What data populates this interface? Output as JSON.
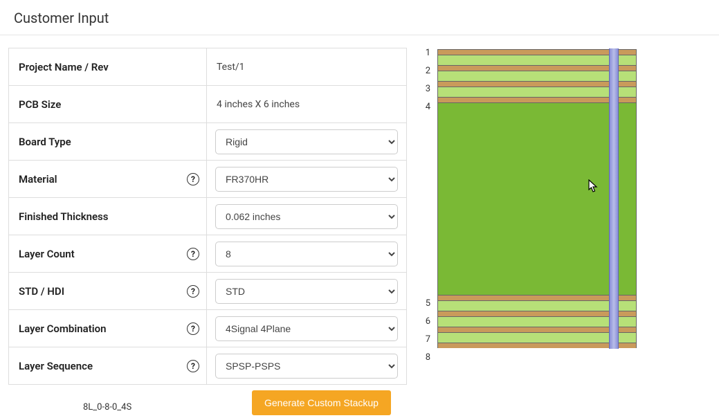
{
  "page": {
    "title": "Customer Input"
  },
  "form": {
    "project_name": {
      "label": "Project Name / Rev",
      "value": "Test/1"
    },
    "pcb_size": {
      "label": "PCB Size",
      "value": "4 inches X 6 inches"
    },
    "board_type": {
      "label": "Board Type",
      "value": "Rigid"
    },
    "material": {
      "label": "Material",
      "value": "FR370HR"
    },
    "finished_thickness": {
      "label": "Finished Thickness",
      "value": "0.062 inches"
    },
    "layer_count": {
      "label": "Layer Count",
      "value": "8"
    },
    "std_hdi": {
      "label": "STD / HDI",
      "value": "STD"
    },
    "layer_combination": {
      "label": "Layer Combination",
      "value": "4Signal 4Plane"
    },
    "layer_sequence": {
      "label": "Layer Sequence",
      "value": "SPSP-PSPS"
    }
  },
  "footer": {
    "code": "8L_0-8-0_4S",
    "button": "Generate Custom Stackup"
  },
  "stackup": {
    "layers": [
      "1",
      "2",
      "3",
      "4",
      "5",
      "6",
      "7",
      "8"
    ]
  },
  "help_glyph": "?"
}
